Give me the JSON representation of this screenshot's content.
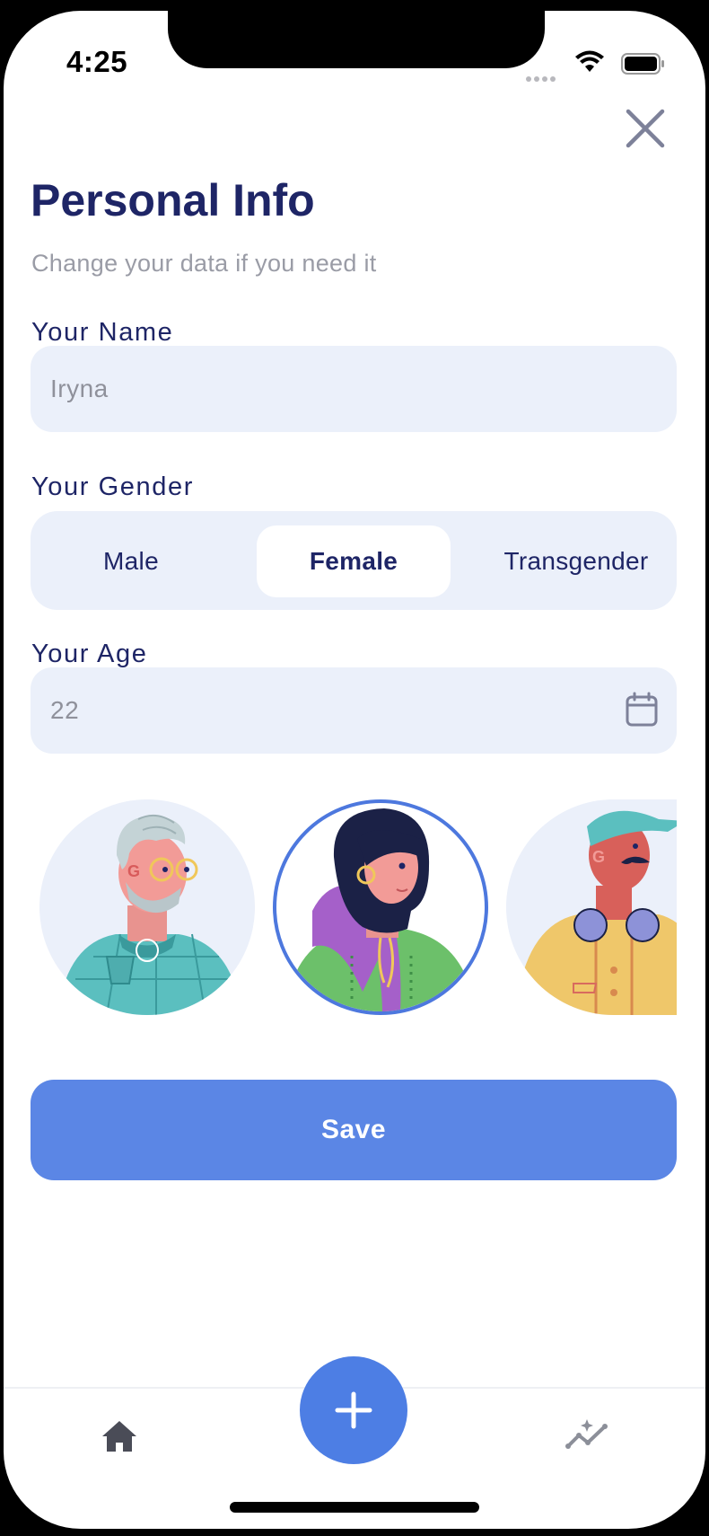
{
  "status_bar": {
    "time": "4:25",
    "icons": [
      "signal-dots-icon",
      "wifi-icon",
      "battery-icon"
    ]
  },
  "header": {
    "close_icon": "close-icon",
    "title": "Personal Info",
    "subtitle": "Change your data if you need it"
  },
  "form": {
    "name": {
      "label": "Your Name",
      "value": "Iryna"
    },
    "gender": {
      "label": "Your Gender",
      "options": [
        "Male",
        "Female",
        "Transgender"
      ],
      "selected": "Female"
    },
    "age": {
      "label": "Your Age",
      "value": "22",
      "icon": "calendar-icon"
    }
  },
  "avatars": [
    {
      "name": "avatar-old-man",
      "selected": false
    },
    {
      "name": "avatar-woman",
      "selected": true
    },
    {
      "name": "avatar-man-cap",
      "selected": false
    }
  ],
  "actions": {
    "save_label": "Save"
  },
  "tab_bar": {
    "items": [
      "home-icon",
      "add-icon",
      "stats-icon"
    ]
  },
  "colors": {
    "primary": "#5b86e5",
    "fab": "#4d7ee4",
    "title": "#1e2566",
    "field_background": "#ebf0fa",
    "muted_text": "#9a9ca6"
  }
}
